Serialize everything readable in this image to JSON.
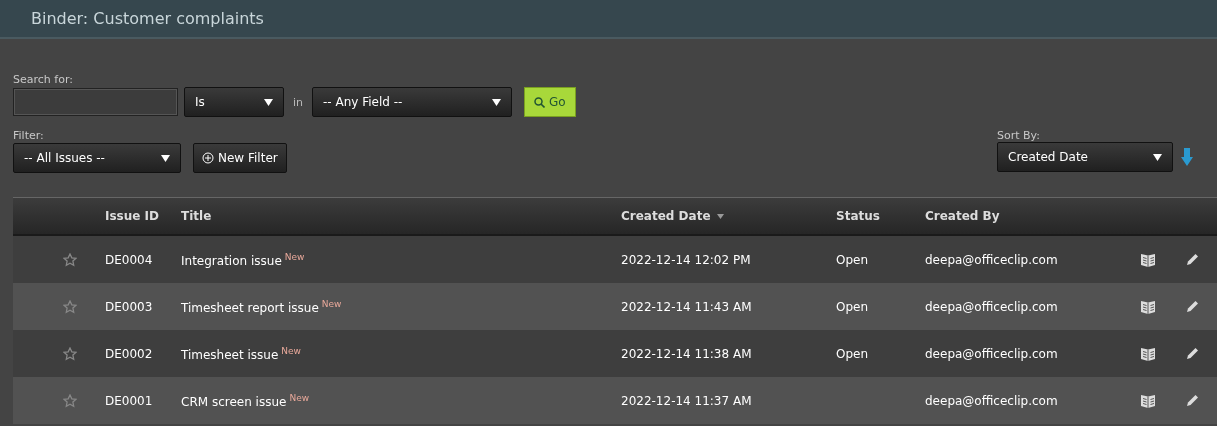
{
  "window": {
    "title": "Binder: Customer complaints"
  },
  "search": {
    "label": "Search for:",
    "operator": "Is",
    "in_label": "in",
    "field": "-- Any Field --",
    "go_button": "Go"
  },
  "filter": {
    "label": "Filter:",
    "value": "-- All Issues --",
    "new_filter_button": "New Filter"
  },
  "sort": {
    "label": "Sort By:",
    "value": "Created Date"
  },
  "table": {
    "columns": [
      {
        "label": "Issue ID",
        "sorted": false
      },
      {
        "label": "Title",
        "sorted": false
      },
      {
        "label": "Created Date",
        "sorted": true
      },
      {
        "label": "Status",
        "sorted": false
      },
      {
        "label": "Created By",
        "sorted": false
      }
    ],
    "rows": [
      {
        "id": "DE0004",
        "title": "Integration issue",
        "badge": "New",
        "created": "2022-12-14 12:02 PM",
        "status": "Open",
        "created_by": "deepa@officeclip.com"
      },
      {
        "id": "DE0003",
        "title": "Timesheet report issue",
        "badge": "New",
        "created": "2022-12-14 11:43 AM",
        "status": "Open",
        "created_by": "deepa@officeclip.com"
      },
      {
        "id": "DE0002",
        "title": "Timesheet issue",
        "badge": "New",
        "created": "2022-12-14 11:38 AM",
        "status": "Open",
        "created_by": "deepa@officeclip.com"
      },
      {
        "id": "DE0001",
        "title": "CRM screen issue",
        "badge": "New",
        "created": "2022-12-14 11:37 AM",
        "created_by": "deepa@officeclip.com"
      }
    ]
  }
}
